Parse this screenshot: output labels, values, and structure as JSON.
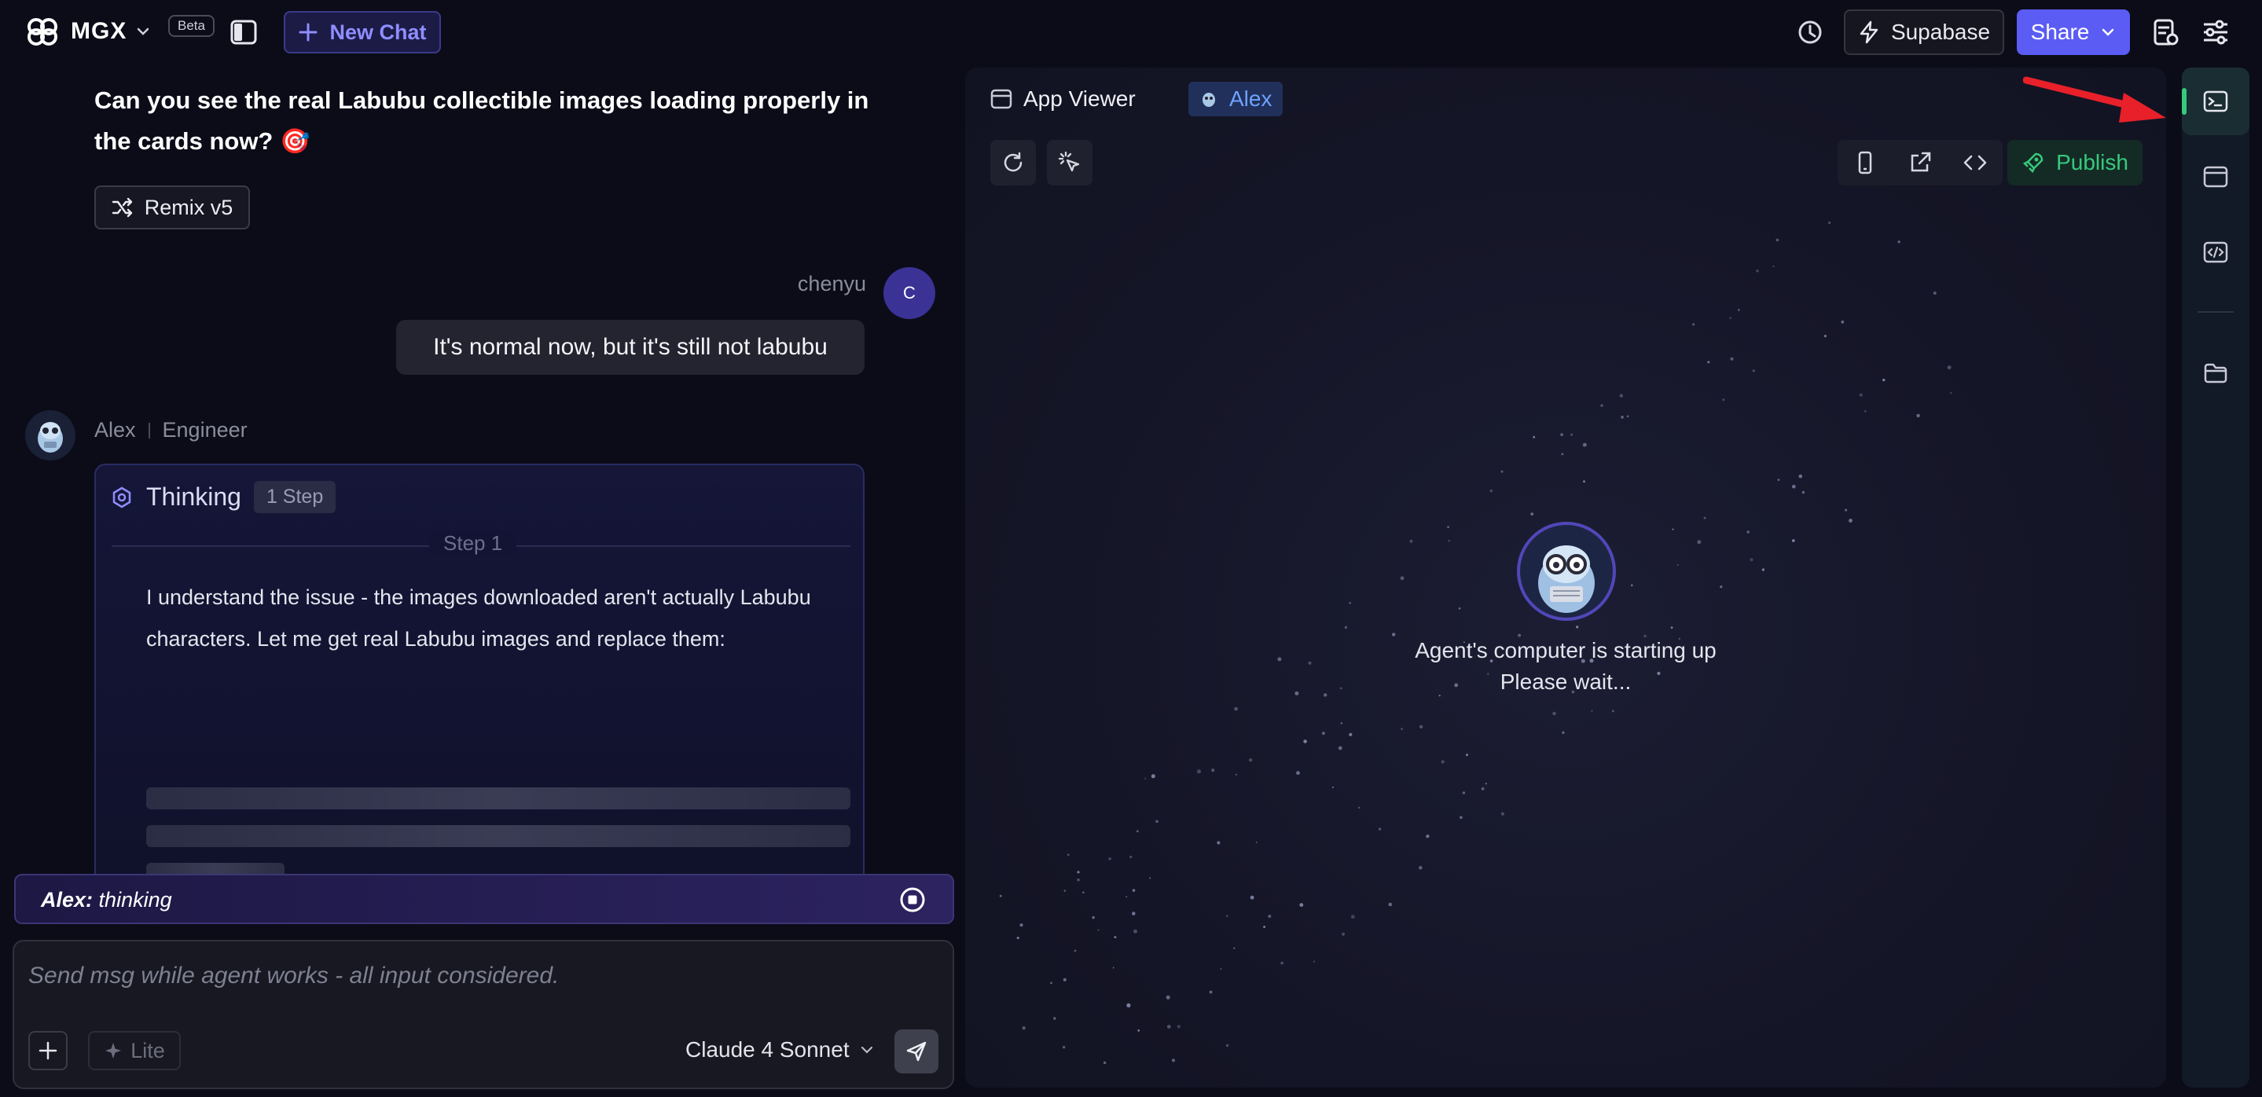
{
  "topbar": {
    "brand": "MGX",
    "beta": "Beta",
    "new_chat": "New Chat",
    "supabase": "Supabase",
    "share": "Share"
  },
  "chat": {
    "question": "Can you see the real Labubu collectible images loading properly in the cards now? 🎯",
    "remix_label": "Remix v5",
    "user": {
      "name": "chenyu",
      "avatar_letter": "C",
      "message": "It's normal now, but it's still not labubu"
    },
    "agent": {
      "name": "Alex",
      "role": "Engineer",
      "thinking_title": "Thinking",
      "step_badge": "1 Step",
      "step_label": "Step 1",
      "thinking_text": "I understand the issue - the images downloaded aren't actually Labubu characters. Let me get real Labubu images and replace them:"
    },
    "status": {
      "agent_name": "Alex:",
      "state": "thinking"
    },
    "composer": {
      "placeholder": "Send msg while agent works - all input considered.",
      "lite_label": "Lite",
      "model": "Claude 4 Sonnet"
    }
  },
  "viewer": {
    "tab_app": "App Viewer",
    "tab_agent": "Alex",
    "publish": "Publish",
    "boot_line1": "Agent's computer is starting up",
    "boot_line2": "Please wait..."
  },
  "colors": {
    "accent": "#5b5cf4",
    "publish_green": "#37c97c",
    "agent_tab_blue": "#6fa2ff",
    "annotation_red": "#e8202a"
  },
  "icons": [
    "mgx-logo-icon",
    "chevron-down-icon",
    "sidebar-toggle-icon",
    "plus-icon",
    "history-icon",
    "lightning-icon",
    "database-icon",
    "settings-sliders-icon",
    "shuffle-icon",
    "brain-icon",
    "stop-circle-icon",
    "sparkle-icon",
    "send-icon",
    "window-icon",
    "refresh-icon",
    "cursor-click-icon",
    "phone-icon",
    "external-link-icon",
    "code-icon",
    "rocket-icon",
    "terminal-icon",
    "browser-icon",
    "file-code-icon",
    "folder-icon"
  ]
}
